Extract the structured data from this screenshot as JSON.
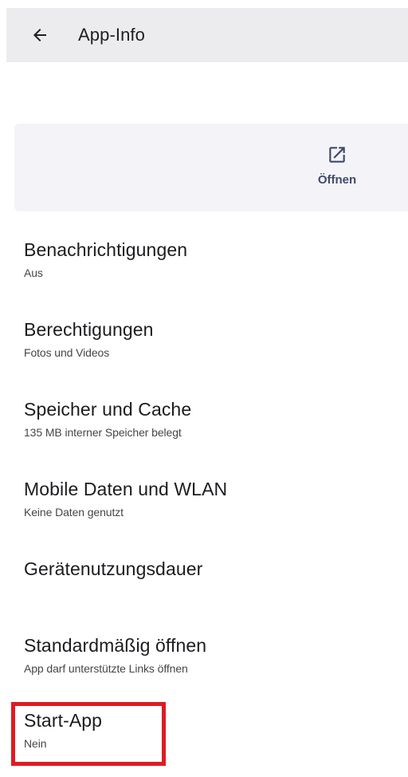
{
  "app_bar": {
    "title": "App-Info",
    "back_icon": "arrow-left-icon"
  },
  "actions": {
    "open_label": "Öffnen",
    "open_icon": "open-external-icon",
    "accent": "#3f4a6b"
  },
  "settings": [
    {
      "title": "Benachrichtigungen",
      "subtitle": "Aus"
    },
    {
      "title": "Berechtigungen",
      "subtitle": "Fotos und Videos"
    },
    {
      "title": "Speicher und Cache",
      "subtitle": "135 MB interner Speicher belegt"
    },
    {
      "title": "Mobile Daten und WLAN",
      "subtitle": "Keine Daten genutzt"
    },
    {
      "title": "Gerätenutzungsdauer",
      "subtitle": ""
    },
    {
      "title": "Standardmäßig öffnen",
      "subtitle": "App darf unterstützte Links öffnen"
    },
    {
      "title": "Start-App",
      "subtitle": "Nein"
    }
  ],
  "colors": {
    "app_bar_bg": "#ececef",
    "card_bg": "#f4f3f8",
    "highlight": "#e01a22"
  }
}
